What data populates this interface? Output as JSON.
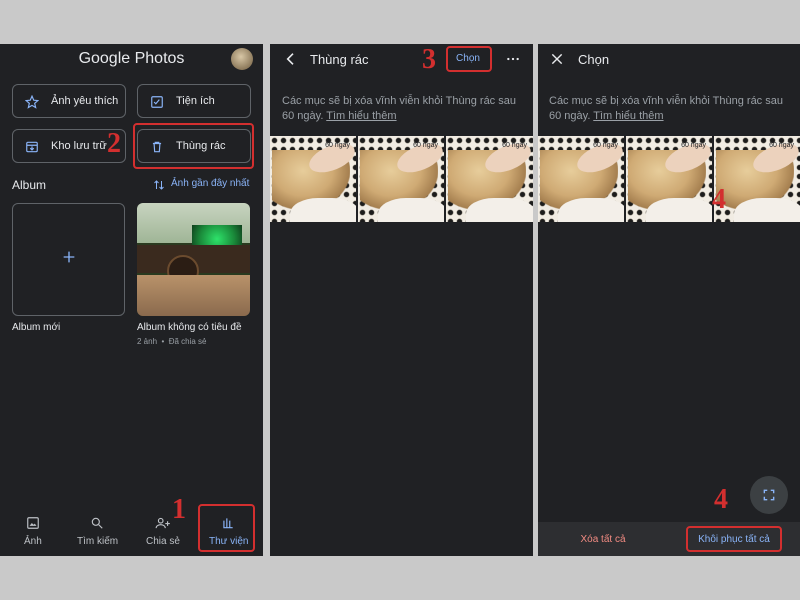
{
  "panel1": {
    "title": "Google Photos",
    "buttons": {
      "favorites": "Ảnh yêu thích",
      "utilities": "Tiện ích",
      "archive": "Kho lưu trữ",
      "trash": "Thùng rác"
    },
    "album_section": {
      "title": "Album",
      "sort_label": "Ảnh gần đây nhất"
    },
    "albums": [
      {
        "name": "Album mới",
        "meta": ""
      },
      {
        "name": "Album không có tiêu đề",
        "meta": "2 ảnh  •  Đã chia sẻ"
      }
    ],
    "nav": [
      {
        "label": "Ảnh",
        "icon": "photo-icon"
      },
      {
        "label": "Tìm kiếm",
        "icon": "search-icon"
      },
      {
        "label": "Chia sẻ",
        "icon": "people-icon"
      },
      {
        "label": "Thư viện",
        "icon": "library-icon"
      }
    ]
  },
  "panel2": {
    "title": "Thùng rác",
    "select_label": "Chọn",
    "description": "Các mục sẽ bị xóa vĩnh viễn khỏi Thùng rác sau 60 ngày.",
    "learn_more": "Tìm hiểu thêm",
    "thumbs": [
      {
        "days": "60 ngày"
      },
      {
        "days": "60 ngày"
      },
      {
        "days": "60 ngày"
      }
    ]
  },
  "panel3": {
    "title": "Chọn",
    "description": "Các mục sẽ bị xóa vĩnh viễn khỏi Thùng rác sau 60 ngày.",
    "learn_more": "Tìm hiểu thêm",
    "thumbs": [
      {
        "days": "60 ngày"
      },
      {
        "days": "60 ngày"
      },
      {
        "days": "60 ngày"
      }
    ],
    "delete_all": "Xóa tất cả",
    "restore_all": "Khôi phục tất cả"
  },
  "annotations": {
    "step1": "1",
    "step2": "2",
    "step3": "3",
    "step4": "4"
  },
  "colors": {
    "accent": "#8ab4f8",
    "danger_text": "#f28b82",
    "annotation": "#d32f2f",
    "panel_bg": "#202124"
  }
}
